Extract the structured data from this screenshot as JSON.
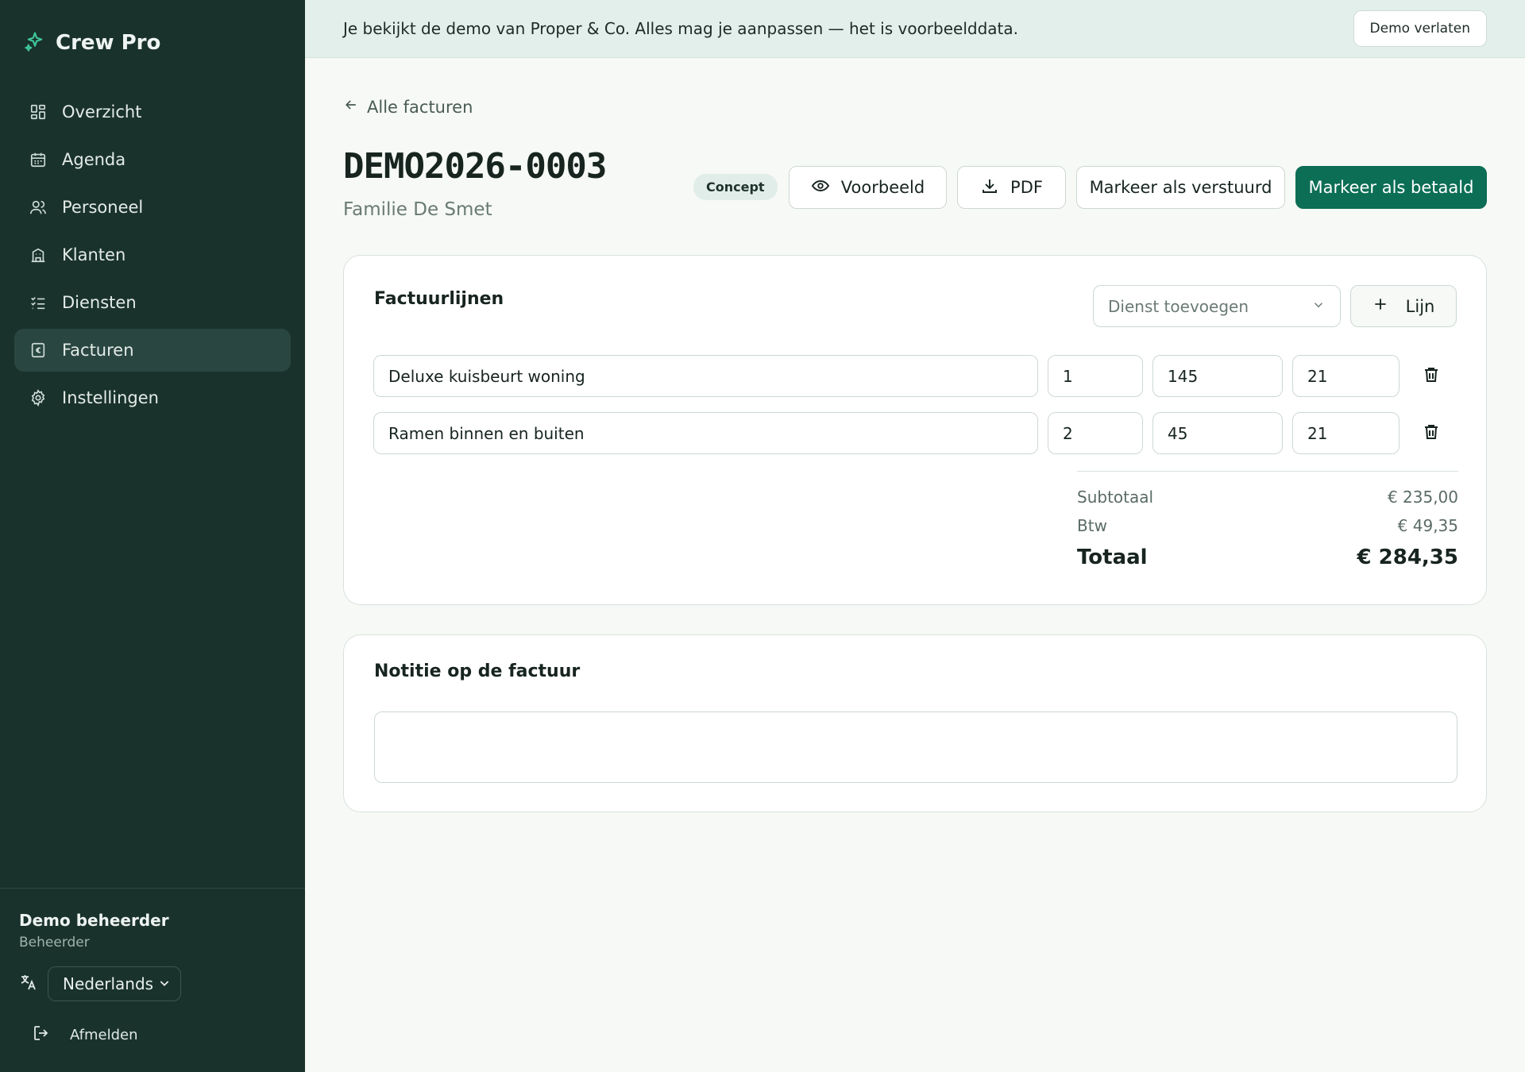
{
  "app": {
    "name": "Crew Pro"
  },
  "sidebar": {
    "items": [
      {
        "label": "Overzicht",
        "icon": "dashboard-icon"
      },
      {
        "label": "Agenda",
        "icon": "calendar-icon"
      },
      {
        "label": "Personeel",
        "icon": "users-icon"
      },
      {
        "label": "Klanten",
        "icon": "building-icon"
      },
      {
        "label": "Diensten",
        "icon": "list-check-icon"
      },
      {
        "label": "Facturen",
        "icon": "invoice-euro-icon",
        "active": true
      },
      {
        "label": "Instellingen",
        "icon": "gear-icon"
      }
    ],
    "user": {
      "name": "Demo beheerder",
      "role": "Beheerder"
    },
    "language": "Nederlands",
    "logout_label": "Afmelden"
  },
  "banner": {
    "text": "Je bekijkt de demo van Proper & Co. Alles mag je aanpassen — het is voorbeelddata.",
    "button": "Demo verlaten"
  },
  "invoice": {
    "back_label": "Alle facturen",
    "number": "DEMO2026-0003",
    "client": "Familie De Smet",
    "status": "Concept",
    "actions": {
      "preview": "Voorbeeld",
      "pdf": "PDF",
      "mark_sent": "Markeer als verstuurd",
      "mark_paid": "Markeer als betaald"
    }
  },
  "lines_card": {
    "title": "Factuurlijnen",
    "service_placeholder": "Dienst toevoegen",
    "add_line": "Lijn",
    "lines": [
      {
        "description": "Deluxe kuisbeurt woning",
        "quantity": "1",
        "price": "145",
        "vat": "21"
      },
      {
        "description": "Ramen binnen en buiten",
        "quantity": "2",
        "price": "45",
        "vat": "21"
      }
    ],
    "totals": {
      "subtotal_label": "Subtotaal",
      "subtotal": "€ 235,00",
      "vat_label": "Btw",
      "vat": "€ 49,35",
      "total_label": "Totaal",
      "total": "€ 284,35"
    }
  },
  "note_card": {
    "title": "Notitie op de factuur",
    "value": ""
  },
  "colors": {
    "sidebar": "#1a322c",
    "accent": "#0b6e55",
    "banner": "#e3efea",
    "background": "#f6f9f5"
  }
}
